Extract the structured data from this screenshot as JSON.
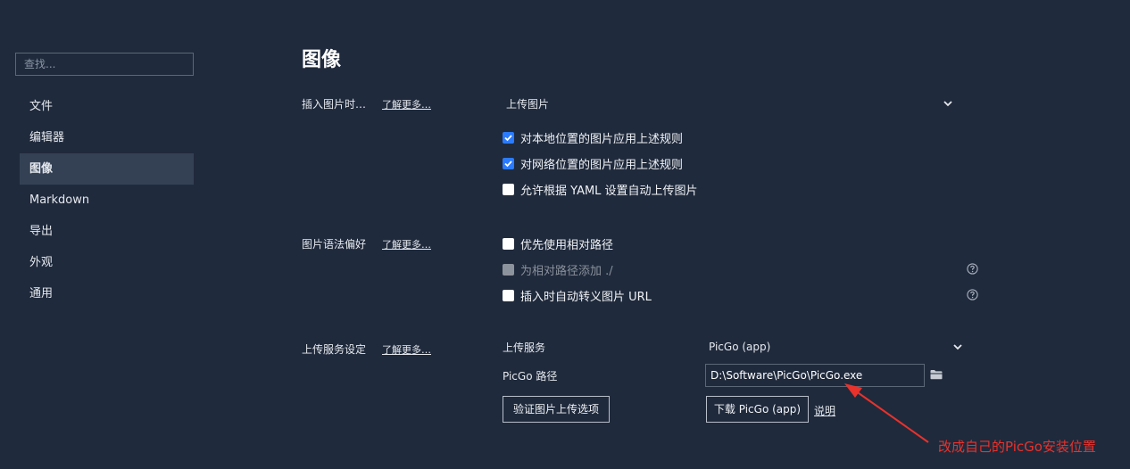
{
  "sidebar": {
    "search_placeholder": "查找...",
    "items": [
      {
        "label": "文件",
        "active": false
      },
      {
        "label": "编辑器",
        "active": false
      },
      {
        "label": "图像",
        "active": true
      },
      {
        "label": "Markdown",
        "active": false
      },
      {
        "label": "导出",
        "active": false
      },
      {
        "label": "外观",
        "active": false
      },
      {
        "label": "通用",
        "active": false
      }
    ]
  },
  "main": {
    "title": "图像",
    "learn_more": "了解更多…",
    "insert": {
      "label": "插入图片时…",
      "select_value": "上传图片",
      "options": [
        {
          "label": "对本地位置的图片应用上述规则",
          "state": "checked"
        },
        {
          "label": "对网络位置的图片应用上述规则",
          "state": "checked"
        },
        {
          "label": "允许根据 YAML 设置自动上传图片",
          "state": "unchecked"
        }
      ]
    },
    "syntax": {
      "label": "图片语法偏好",
      "options": [
        {
          "label": "优先使用相对路径",
          "state": "unchecked"
        },
        {
          "label": "为相对路径添加 ./",
          "state": "disabled"
        },
        {
          "label": "插入时自动转义图片 URL",
          "state": "unchecked"
        }
      ]
    },
    "upload": {
      "label": "上传服务设定",
      "service_label": "上传服务",
      "service_value": "PicGo (app)",
      "path_label": "PicGo 路径",
      "path_value": "D:\\Software\\PicGo\\PicGo.exe",
      "verify_button": "验证图片上传选项",
      "download_button": "下载 PicGo (app)",
      "help_link": "说明"
    }
  },
  "annotation": {
    "text": "改成自己的PicGo安装位置",
    "color": "#e8322c"
  },
  "icons": {
    "check": "check-icon",
    "chevron": "chevron-down-icon",
    "help": "question-circle-icon",
    "folder": "folder-icon"
  },
  "colors": {
    "background": "#1f2a3c",
    "sidebar_active": "#344155",
    "checkbox_checked": "#2b7bff",
    "annotation": "#e8322c"
  }
}
